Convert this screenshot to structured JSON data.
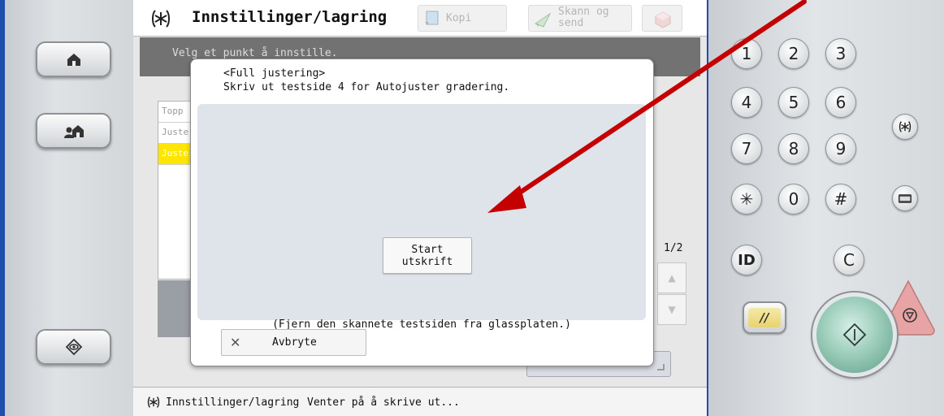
{
  "window": {
    "title": "Innstillinger/lagring",
    "subtitle": "Velg et punkt å innstille."
  },
  "top_tabs": {
    "copy": "Kopi",
    "scan_send_line1": "Skann og",
    "scan_send_line2": "send"
  },
  "list": {
    "items": [
      "Topp",
      "Juste",
      "Juste"
    ],
    "selected_index": 2
  },
  "pager": {
    "page": "1/2"
  },
  "dialog": {
    "heading": "<Full justering>",
    "instruction": "Skriv ut testside 4 for Autojuster gradering.",
    "start_button": "Start utskrift",
    "hint": "(Fjern den skannete testsiden fra glassplaten.)",
    "cancel_button": "Avbryte"
  },
  "status_bar": {
    "title": "Innstillinger/lagring",
    "status": "Venter på å skrive ut..."
  },
  "keypad": {
    "keys": [
      "1",
      "2",
      "3",
      "4",
      "5",
      "6",
      "7",
      "8",
      "9",
      "✳",
      "0",
      "#"
    ],
    "id_key": "ID",
    "clear_key": "C",
    "reset_key": "//"
  },
  "colors": {
    "panel_border": "#1f4fae",
    "selected_row": "#ffe600",
    "annotation_arrow": "#c40000",
    "start_key": "#9ccdbb",
    "stop_key": "#e7a3a3"
  },
  "icons": {
    "left_panel": [
      "home-icon",
      "user-home-icon",
      "settings-eye-icon"
    ],
    "title": "settings-icon",
    "status": "settings-icon",
    "start": "start-icon",
    "stop": "stop-icon",
    "counter": "counter-check-icon"
  }
}
